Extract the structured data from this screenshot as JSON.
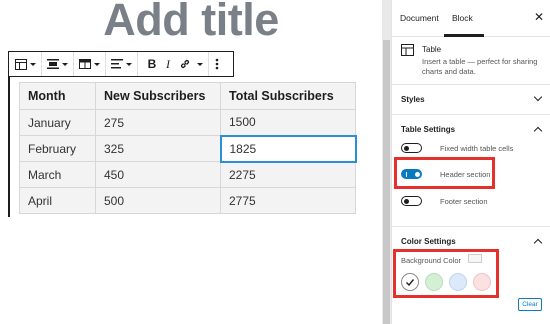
{
  "editor": {
    "title": "Add title"
  },
  "toolbar": {
    "items": [
      "table-icon",
      "align-center-icon",
      "table-columns-icon",
      "align-left-icon",
      "bold-icon",
      "italic-icon",
      "link-icon",
      "more-options-icon"
    ],
    "bold_label": "B",
    "italic_label": "I"
  },
  "table": {
    "headers": [
      "Month",
      "New Subscribers",
      "Total Subscribers"
    ],
    "rows": [
      [
        "January",
        "275",
        "1500"
      ],
      [
        "February",
        "325",
        "1825"
      ],
      [
        "March",
        "450",
        "2275"
      ],
      [
        "April",
        "500",
        "2775"
      ]
    ],
    "active_cell": "February / Total Subscribers"
  },
  "sidebar": {
    "tabs": [
      "Document",
      "Block"
    ],
    "active_tab": "Block",
    "close_label": "✕",
    "block_card": {
      "title": "Table",
      "description": "Insert a table — perfect for sharing charts and data."
    },
    "styles_label": "Styles",
    "table_settings": {
      "label": "Table Settings",
      "toggles": [
        {
          "label": "Fixed width table cells",
          "on": false
        },
        {
          "label": "Header section",
          "on": true
        },
        {
          "label": "Footer section",
          "on": false
        }
      ]
    },
    "color_settings": {
      "label": "Color Settings",
      "background_label": "Background Color",
      "swatches": [
        "#ffffff",
        "#d4f0d4",
        "#dbe9fb",
        "#fbe1e1"
      ],
      "clear_label": "Clear"
    }
  },
  "colors": {
    "accent": "#0a7ac0",
    "highlight_box": "#e4312c",
    "active_cell_border": "#2b8ed6"
  }
}
